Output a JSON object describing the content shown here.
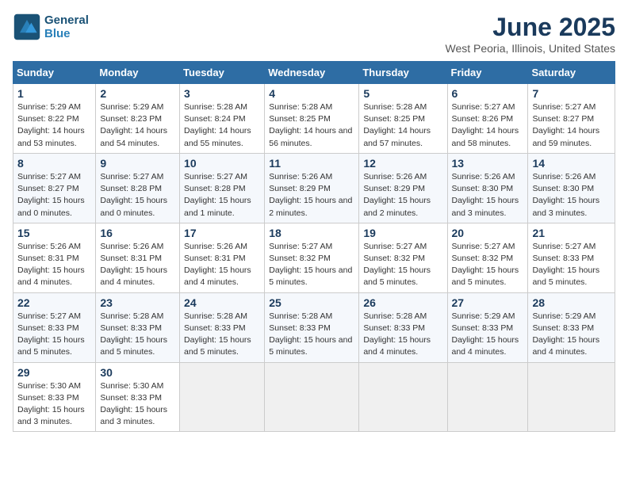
{
  "header": {
    "logo_line1": "General",
    "logo_line2": "Blue",
    "title": "June 2025",
    "subtitle": "West Peoria, Illinois, United States"
  },
  "days_of_week": [
    "Sunday",
    "Monday",
    "Tuesday",
    "Wednesday",
    "Thursday",
    "Friday",
    "Saturday"
  ],
  "weeks": [
    [
      {
        "num": "1",
        "rise": "5:29 AM",
        "set": "8:22 PM",
        "daylight": "14 hours and 53 minutes."
      },
      {
        "num": "2",
        "rise": "5:29 AM",
        "set": "8:23 PM",
        "daylight": "14 hours and 54 minutes."
      },
      {
        "num": "3",
        "rise": "5:28 AM",
        "set": "8:24 PM",
        "daylight": "14 hours and 55 minutes."
      },
      {
        "num": "4",
        "rise": "5:28 AM",
        "set": "8:25 PM",
        "daylight": "14 hours and 56 minutes."
      },
      {
        "num": "5",
        "rise": "5:28 AM",
        "set": "8:25 PM",
        "daylight": "14 hours and 57 minutes."
      },
      {
        "num": "6",
        "rise": "5:27 AM",
        "set": "8:26 PM",
        "daylight": "14 hours and 58 minutes."
      },
      {
        "num": "7",
        "rise": "5:27 AM",
        "set": "8:27 PM",
        "daylight": "14 hours and 59 minutes."
      }
    ],
    [
      {
        "num": "8",
        "rise": "5:27 AM",
        "set": "8:27 PM",
        "daylight": "15 hours and 0 minutes."
      },
      {
        "num": "9",
        "rise": "5:27 AM",
        "set": "8:28 PM",
        "daylight": "15 hours and 0 minutes."
      },
      {
        "num": "10",
        "rise": "5:27 AM",
        "set": "8:28 PM",
        "daylight": "15 hours and 1 minute."
      },
      {
        "num": "11",
        "rise": "5:26 AM",
        "set": "8:29 PM",
        "daylight": "15 hours and 2 minutes."
      },
      {
        "num": "12",
        "rise": "5:26 AM",
        "set": "8:29 PM",
        "daylight": "15 hours and 2 minutes."
      },
      {
        "num": "13",
        "rise": "5:26 AM",
        "set": "8:30 PM",
        "daylight": "15 hours and 3 minutes."
      },
      {
        "num": "14",
        "rise": "5:26 AM",
        "set": "8:30 PM",
        "daylight": "15 hours and 3 minutes."
      }
    ],
    [
      {
        "num": "15",
        "rise": "5:26 AM",
        "set": "8:31 PM",
        "daylight": "15 hours and 4 minutes."
      },
      {
        "num": "16",
        "rise": "5:26 AM",
        "set": "8:31 PM",
        "daylight": "15 hours and 4 minutes."
      },
      {
        "num": "17",
        "rise": "5:26 AM",
        "set": "8:31 PM",
        "daylight": "15 hours and 4 minutes."
      },
      {
        "num": "18",
        "rise": "5:27 AM",
        "set": "8:32 PM",
        "daylight": "15 hours and 5 minutes."
      },
      {
        "num": "19",
        "rise": "5:27 AM",
        "set": "8:32 PM",
        "daylight": "15 hours and 5 minutes."
      },
      {
        "num": "20",
        "rise": "5:27 AM",
        "set": "8:32 PM",
        "daylight": "15 hours and 5 minutes."
      },
      {
        "num": "21",
        "rise": "5:27 AM",
        "set": "8:33 PM",
        "daylight": "15 hours and 5 minutes."
      }
    ],
    [
      {
        "num": "22",
        "rise": "5:27 AM",
        "set": "8:33 PM",
        "daylight": "15 hours and 5 minutes."
      },
      {
        "num": "23",
        "rise": "5:28 AM",
        "set": "8:33 PM",
        "daylight": "15 hours and 5 minutes."
      },
      {
        "num": "24",
        "rise": "5:28 AM",
        "set": "8:33 PM",
        "daylight": "15 hours and 5 minutes."
      },
      {
        "num": "25",
        "rise": "5:28 AM",
        "set": "8:33 PM",
        "daylight": "15 hours and 5 minutes."
      },
      {
        "num": "26",
        "rise": "5:28 AM",
        "set": "8:33 PM",
        "daylight": "15 hours and 4 minutes."
      },
      {
        "num": "27",
        "rise": "5:29 AM",
        "set": "8:33 PM",
        "daylight": "15 hours and 4 minutes."
      },
      {
        "num": "28",
        "rise": "5:29 AM",
        "set": "8:33 PM",
        "daylight": "15 hours and 4 minutes."
      }
    ],
    [
      {
        "num": "29",
        "rise": "5:30 AM",
        "set": "8:33 PM",
        "daylight": "15 hours and 3 minutes."
      },
      {
        "num": "30",
        "rise": "5:30 AM",
        "set": "8:33 PM",
        "daylight": "15 hours and 3 minutes."
      },
      null,
      null,
      null,
      null,
      null
    ]
  ]
}
